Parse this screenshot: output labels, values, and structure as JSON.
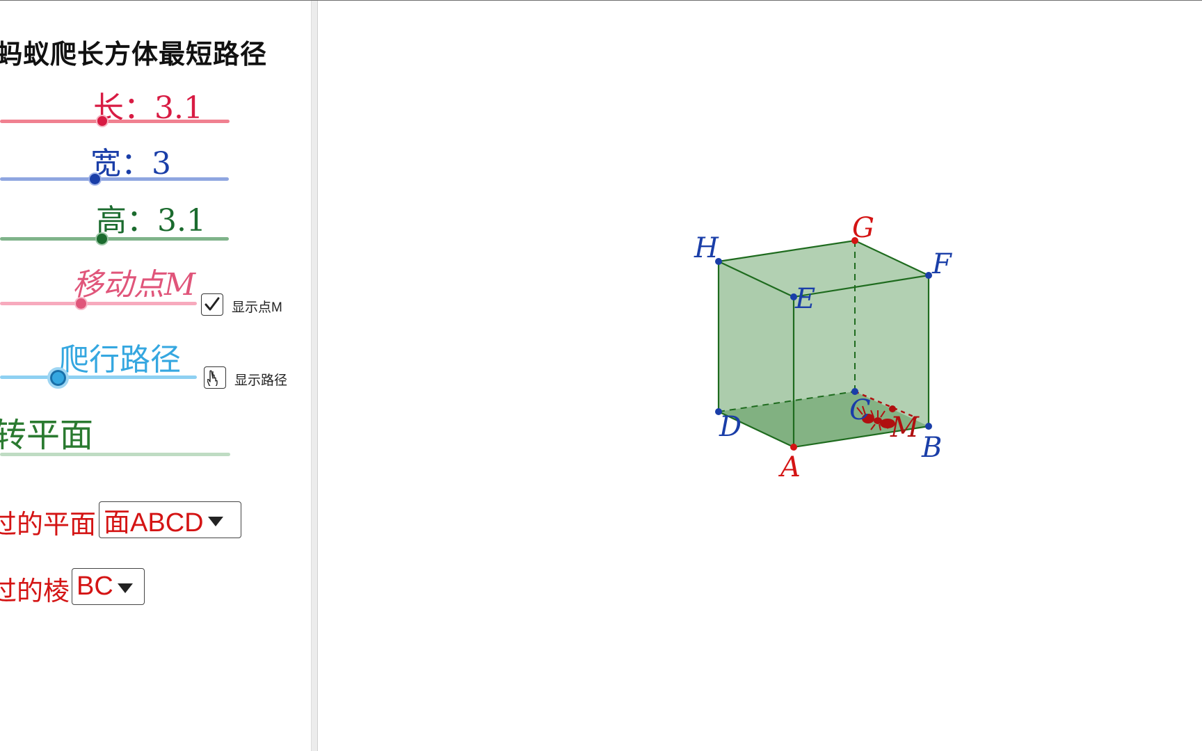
{
  "panel": {
    "title": "蚂蚁爬长方体最短路径",
    "sliders": {
      "length": {
        "label": "长：3.1",
        "value": 3.1,
        "color": "#d81b43",
        "track_color": "#f08090"
      },
      "width": {
        "label": "宽：3",
        "value": 3,
        "color": "#1a3ea8",
        "track_color": "#8fa6e0"
      },
      "height": {
        "label": "高：3.1",
        "value": 3.1,
        "color": "#1b6b2e",
        "track_color": "#7fb38a"
      },
      "move_point": {
        "label": "移动点M",
        "color": "#e0557a",
        "track_color": "#f7aabd"
      },
      "crawl_path": {
        "label": "爬行路径",
        "color": "#35a7e0",
        "track_color": "#8ed0f2"
      },
      "rotate_plane": {
        "label": "转平面",
        "color": "#2a7a30",
        "track_color": "#bfdcc3"
      }
    },
    "checkboxes": {
      "show_point": {
        "label": "显示点M",
        "checked": true
      },
      "show_path": {
        "label": "显示路径",
        "checked": false
      }
    },
    "dropdowns": {
      "plane": {
        "label": "过的平面",
        "value": "面ABCD"
      },
      "edge": {
        "label": "过的棱",
        "value": "BC"
      }
    }
  },
  "figure": {
    "face_color": "#7fb07f",
    "edge_color": "#1e6b1e",
    "points": {
      "A": {
        "label": "A",
        "color": "#d41414"
      },
      "B": {
        "label": "B",
        "color": "#1a3ea8"
      },
      "C": {
        "label": "C",
        "color": "#1a3ea8"
      },
      "D": {
        "label": "D",
        "color": "#1a3ea8"
      },
      "E": {
        "label": "E",
        "color": "#1a3ea8"
      },
      "F": {
        "label": "F",
        "color": "#1a3ea8"
      },
      "G": {
        "label": "G",
        "color": "#d41414"
      },
      "H": {
        "label": "H",
        "color": "#1a3ea8"
      },
      "M": {
        "label": "M",
        "color": "#b01010"
      }
    }
  }
}
